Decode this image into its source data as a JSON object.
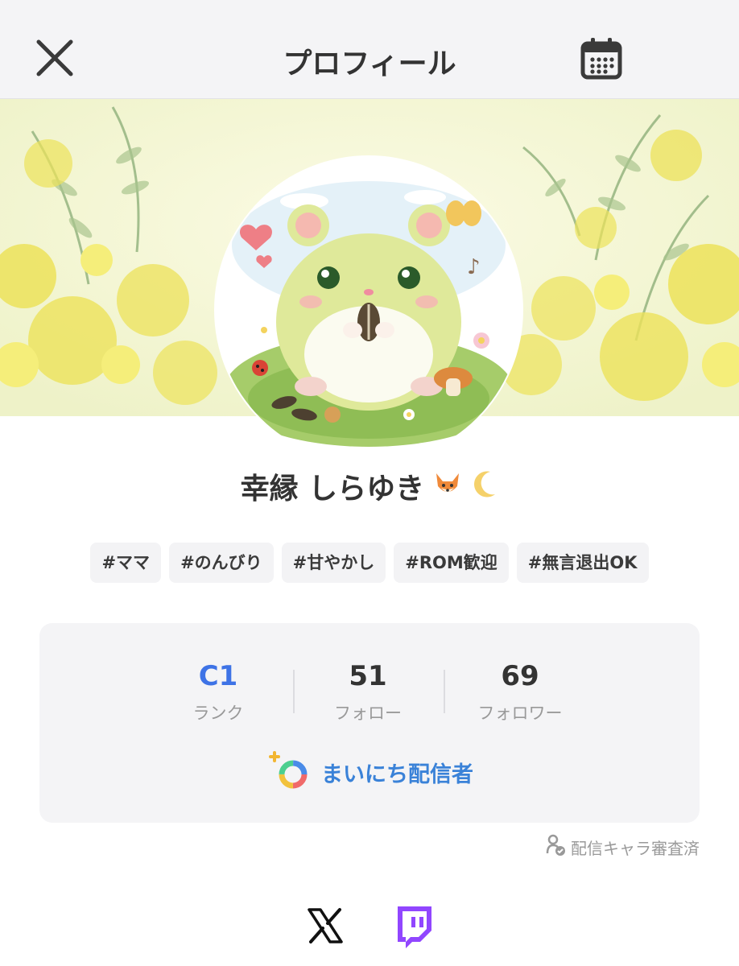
{
  "header": {
    "title": "プロフィール",
    "close_icon": "close-icon",
    "calendar_icon": "calendar-icon"
  },
  "profile": {
    "name": "幸縁 しらゆき",
    "name_emoji": [
      "fox-face-emoji",
      "crescent-moon-emoji"
    ],
    "avatar": "hamster-eating-sunflower-seed-illustration",
    "banner": "mimosa-flowers-watercolor"
  },
  "tags": [
    "#ママ",
    "#のんびり",
    "#甘やかし",
    "#ROM歓迎",
    "#無言退出OK"
  ],
  "stats": {
    "rank": {
      "value": "C1",
      "label": "ランク"
    },
    "follow": {
      "value": "51",
      "label": "フォロー"
    },
    "followers": {
      "value": "69",
      "label": "フォロワー"
    }
  },
  "daily_streamer": {
    "label": "まいにち配信者",
    "icon": "rainbow-ring-plus-icon"
  },
  "verified": {
    "label": "配信キャラ審査済",
    "icon": "character-check-icon"
  },
  "social": [
    {
      "name": "X",
      "icon": "x-logo-icon"
    },
    {
      "name": "Twitch",
      "icon": "twitch-logo-icon"
    }
  ],
  "colors": {
    "accent_blue": "#3a82d8",
    "rank_blue": "#3e73e6",
    "twitch_purple": "#9146ff",
    "banner_yellow": "#f1ee8a"
  }
}
